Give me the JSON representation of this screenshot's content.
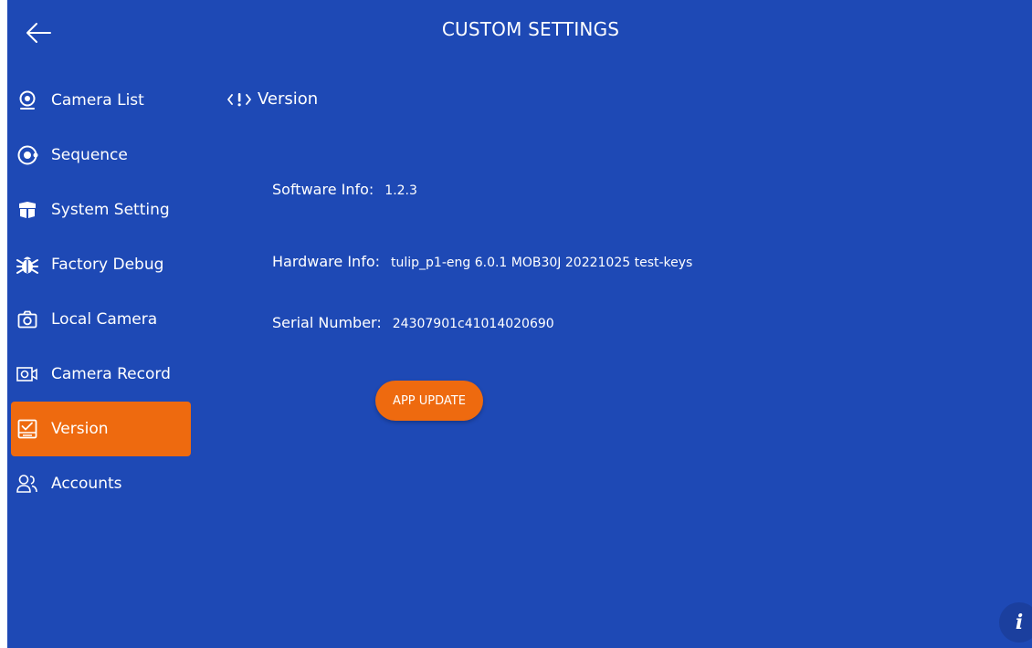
{
  "header": {
    "title": "CUSTOM SETTINGS"
  },
  "sidebar": {
    "items": [
      {
        "label": "Camera List",
        "icon": "webcam-icon"
      },
      {
        "label": "Sequence",
        "icon": "sequence-icon"
      },
      {
        "label": "System Setting",
        "icon": "box-icon"
      },
      {
        "label": "Factory Debug",
        "icon": "bug-icon"
      },
      {
        "label": "Local Camera",
        "icon": "camera-icon"
      },
      {
        "label": "Camera Record",
        "icon": "video-camera-icon"
      },
      {
        "label": "Version",
        "icon": "checked-screen-icon",
        "active": true
      },
      {
        "label": "Accounts",
        "icon": "users-icon"
      }
    ]
  },
  "content": {
    "section_title": "Version",
    "software_info": {
      "label": "Software Info:",
      "value": "1.2.3"
    },
    "hardware_info": {
      "label": "Hardware Info:",
      "value": "tulip_p1-eng 6.0.1 MOB30J 20221025 test-keys"
    },
    "serial_number": {
      "label": "Serial Number:",
      "value": "24307901c41014020690"
    },
    "update_button": "APP UPDATE"
  },
  "info_button": {
    "label": "i"
  },
  "colors": {
    "background": "#1e49b5",
    "accent": "#ee6a0f",
    "text": "#ffffff"
  }
}
